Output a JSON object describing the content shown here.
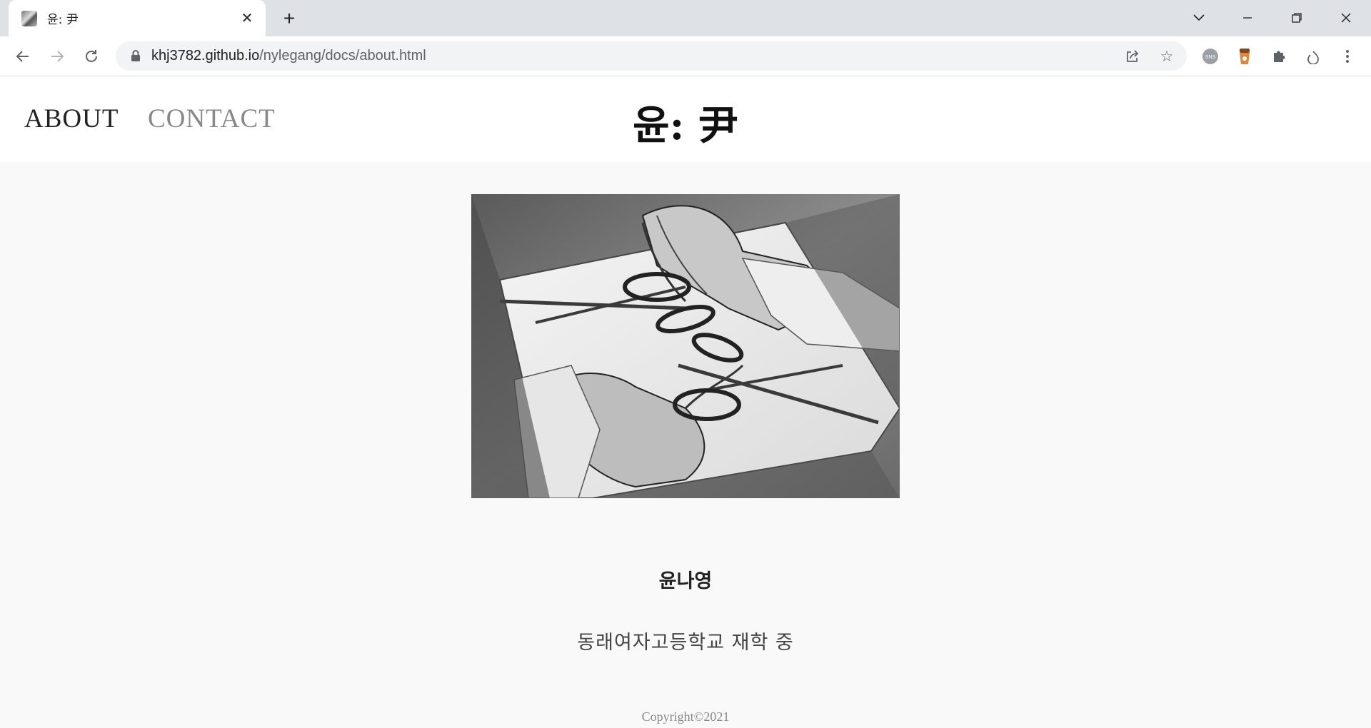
{
  "browser": {
    "tab_title": "윤: 尹",
    "url_host": "khj3782.github.io",
    "url_path": "/nylegang/docs/about.html",
    "icons": {
      "back": "arrow-left-icon",
      "forward": "arrow-right-icon",
      "reload": "reload-icon",
      "lock": "lock-icon",
      "share": "share-icon",
      "bookmark": "star-icon",
      "extensions": "puzzle-icon",
      "menu": "kebab-menu-icon"
    }
  },
  "site": {
    "logo": "윤: 尹",
    "nav": {
      "about": "ABOUT",
      "contact": "CONTACT"
    }
  },
  "profile": {
    "name": "윤나영",
    "description": "동래여자고등학교 재학 중"
  },
  "footer": {
    "copyright": "Copyright©2021"
  },
  "colors": {
    "page_bg": "#f9f9f9",
    "header_bg": "#ffffff",
    "nav_active": "#222222",
    "nav_inactive": "#888888"
  }
}
